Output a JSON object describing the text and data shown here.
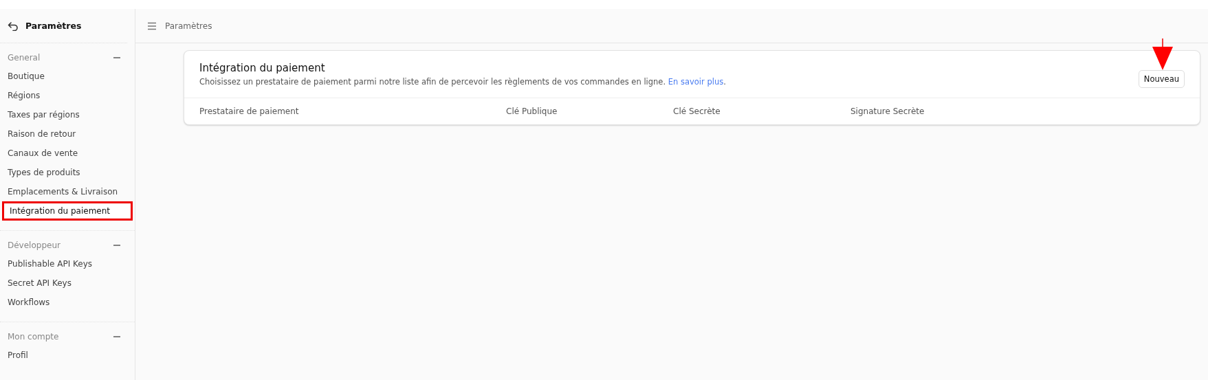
{
  "sidebar": {
    "title": "Paramètres",
    "groups": [
      {
        "label": "General",
        "expanded": true,
        "items": [
          {
            "label": "Boutique",
            "selected": false
          },
          {
            "label": "Régions",
            "selected": false
          },
          {
            "label": "Taxes par régions",
            "selected": false
          },
          {
            "label": "Raison de retour",
            "selected": false
          },
          {
            "label": "Canaux de vente",
            "selected": false
          },
          {
            "label": "Types de produits",
            "selected": false
          },
          {
            "label": "Emplacements & Livraison",
            "selected": false
          },
          {
            "label": "Intégration du paiement",
            "selected": true
          }
        ]
      },
      {
        "label": "Développeur",
        "expanded": true,
        "items": [
          {
            "label": "Publishable API Keys",
            "selected": false
          },
          {
            "label": "Secret API Keys",
            "selected": false
          },
          {
            "label": "Workflows",
            "selected": false
          }
        ]
      },
      {
        "label": "Mon compte",
        "expanded": true,
        "items": [
          {
            "label": "Profil",
            "selected": false
          }
        ]
      }
    ]
  },
  "header": {
    "breadcrumb": "Paramètres"
  },
  "card": {
    "title": "Intégration du paiement",
    "description": "Choisissez un prestataire de paiement parmi notre liste afin de percevoir les règlements de vos commandes en ligne.",
    "link": "En savoir plus",
    "link_suffix": ".",
    "button": "Nouveau",
    "columns": [
      "Prestataire de paiement",
      "Clé Publique",
      "Clé Secrète",
      "Signature Secrète"
    ]
  }
}
